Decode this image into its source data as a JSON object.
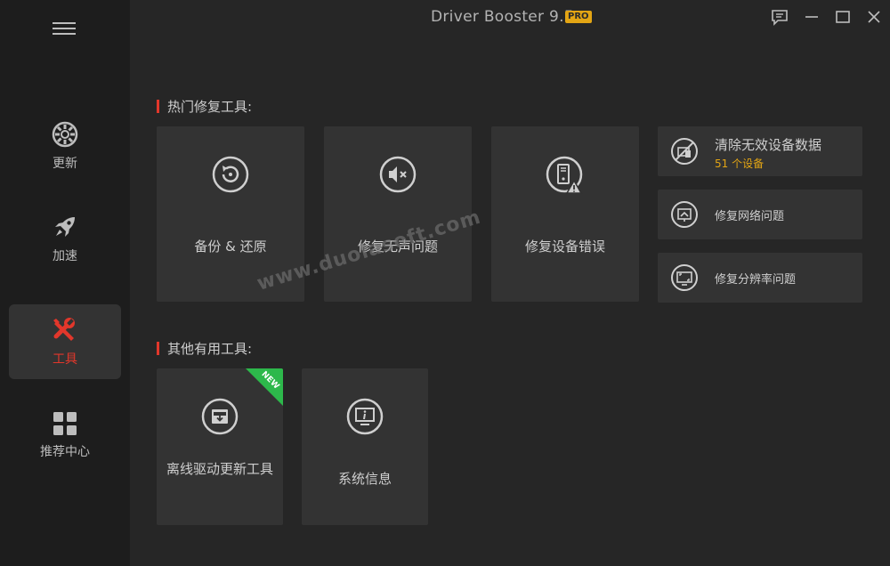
{
  "app": {
    "title": "Driver Booster 9.5",
    "badge": "PRO"
  },
  "sidebar": {
    "items": [
      {
        "label": "更新",
        "icon": "update-icon"
      },
      {
        "label": "加速",
        "icon": "rocket-icon"
      },
      {
        "label": "工具",
        "icon": "tools-icon",
        "active": true
      },
      {
        "label": "推荐中心",
        "icon": "grid-icon"
      }
    ]
  },
  "sections": {
    "hot_title": "热门修复工具:",
    "other_title": "其他有用工具:"
  },
  "hot_tools": [
    {
      "label": "备份 & 还原",
      "icon": "backup-restore-icon"
    },
    {
      "label": "修复无声问题",
      "icon": "mute-speaker-icon"
    },
    {
      "label": "修复设备错误",
      "icon": "device-warning-icon"
    }
  ],
  "side_tools": [
    {
      "label": "清除无效设备数据",
      "sub": "51 个设备",
      "icon": "device-clean-icon"
    },
    {
      "label": "修复网络问题",
      "icon": "network-icon"
    },
    {
      "label": "修复分辨率问题",
      "icon": "resolution-icon"
    }
  ],
  "other_tools": [
    {
      "label": "离线驱动更新工具",
      "icon": "offline-driver-icon",
      "badge": "NEW"
    },
    {
      "label": "系统信息",
      "icon": "system-info-icon"
    }
  ],
  "watermark": "www.duolasoft.com",
  "colors": {
    "accent": "#e2372b",
    "pro": "#e3a514",
    "sub": "#e3a514",
    "new": "#2db84b"
  }
}
